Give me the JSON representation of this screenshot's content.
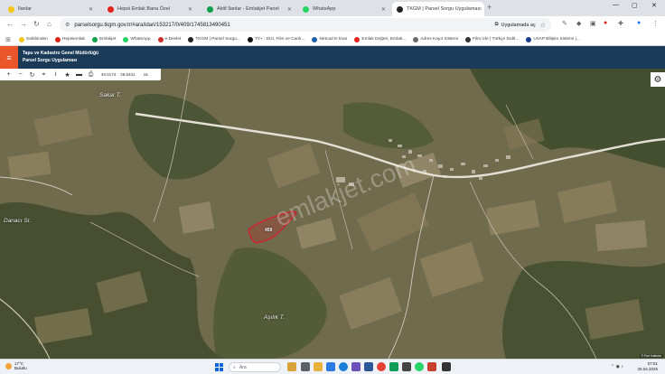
{
  "tabs": [
    {
      "label": "İlanlar",
      "color": "#f5c518",
      "active": false
    },
    {
      "label": "Hepsi Emlak Bana Özel",
      "color": "#e2231a",
      "active": false
    },
    {
      "label": "Aktif İlanlar - Emlakjet Panel",
      "color": "#0ca14a",
      "active": false
    },
    {
      "label": "WhatsApp",
      "color": "#25d366",
      "active": false
    },
    {
      "label": "TKGM | Parsel Sorgu Uygulaması",
      "color": "#222222",
      "active": true
    }
  ],
  "toolbar": {
    "url": "parselsorgu.tkgm.gov.tr/#ara/idari/153217/0/409/1745813490451",
    "chip_label": "Uygulamada aç"
  },
  "bookmarks": [
    {
      "label": "Sahibinden",
      "color": "#f5c518"
    },
    {
      "label": "Hepsiemlak",
      "color": "#e2231a"
    },
    {
      "label": "Emlakjet",
      "color": "#0ca14a"
    },
    {
      "label": "WhatsApp",
      "color": "#25d366"
    },
    {
      "label": "e-Devlet",
      "color": "#c9302c"
    },
    {
      "label": "TKGM | Parsel Sorgu...",
      "color": "#222222"
    },
    {
      "label": "TV+ : Dizi, Film ve Canlı...",
      "color": "#111111"
    },
    {
      "label": "Netcad E-İmar",
      "color": "#1f5fa8"
    },
    {
      "label": "Emlak Değeri, Emlak...",
      "color": "#e2231a"
    },
    {
      "label": "Adres Kayıt Sistemi",
      "color": "#6c6c6c"
    },
    {
      "label": "Film izle | Türkçe Dubl...",
      "color": "#333333"
    },
    {
      "label": "UVAP Bilişim Sistemi |...",
      "color": "#1a3a8a"
    }
  ],
  "app": {
    "title_line1": "Tapu ve Kadastro Genel Müdürlüğü",
    "title_line2": "Parsel Sorgu Uygulaması"
  },
  "map": {
    "coord_a": "40.0174",
    "coord_b": "28.6431",
    "zoom": "16",
    "labels": {
      "sakar": "Sakar T.",
      "danaci": "Danacı Sr.",
      "asilik": "Aşılık T."
    },
    "parcel_number": "459",
    "watermark": "emlakjet.com",
    "attribution": "© Esri Katkılar"
  },
  "taskbar": {
    "temperature": "17°C",
    "weather": "Bulutlu",
    "search_placeholder": "Ara",
    "time": "07:51",
    "date": "28.04.2025"
  }
}
